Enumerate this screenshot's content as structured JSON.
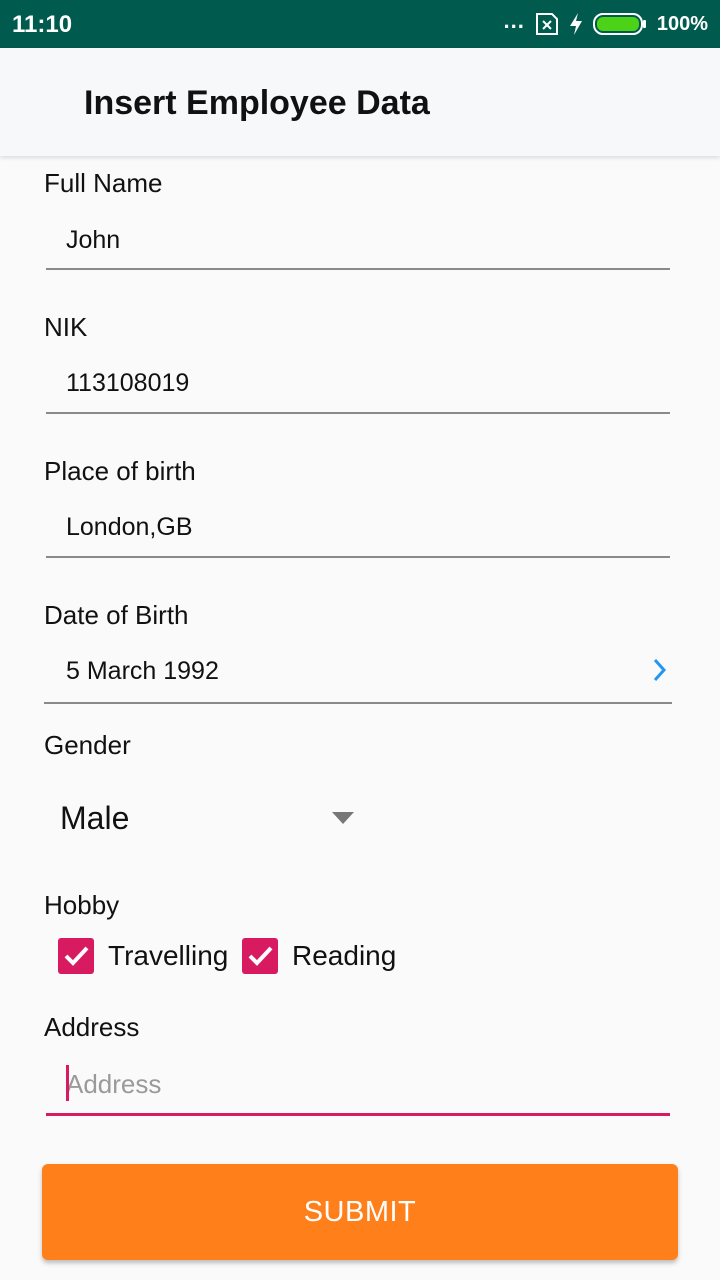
{
  "status_bar": {
    "time": "11:10",
    "more": "...",
    "battery_percent": "100%",
    "battery_level": 1.0,
    "background_color": "#005a4e"
  },
  "app_bar": {
    "title": "Insert Employee Data"
  },
  "form": {
    "full_name": {
      "label": "Full Name",
      "value": "John"
    },
    "nik": {
      "label": "NIK",
      "value": "113108019"
    },
    "place_of_birth": {
      "label": "Place of birth",
      "value": "London,GB"
    },
    "date_of_birth": {
      "label": "Date of Birth",
      "value": "5 March 1992",
      "icon": "chevron-right-icon"
    },
    "gender": {
      "label": "Gender",
      "selected": "Male",
      "icon": "dropdown-arrow-icon"
    },
    "hobby": {
      "label": "Hobby",
      "options": [
        {
          "label": "Travelling",
          "checked": true
        },
        {
          "label": "Reading",
          "checked": true
        }
      ]
    },
    "address": {
      "label": "Address",
      "value": "",
      "placeholder": "Address"
    }
  },
  "submit": {
    "label": "SUBMIT"
  },
  "colors": {
    "accent": "#d81b60",
    "button": "#ff7f1a",
    "chevron": "#2196f3"
  }
}
